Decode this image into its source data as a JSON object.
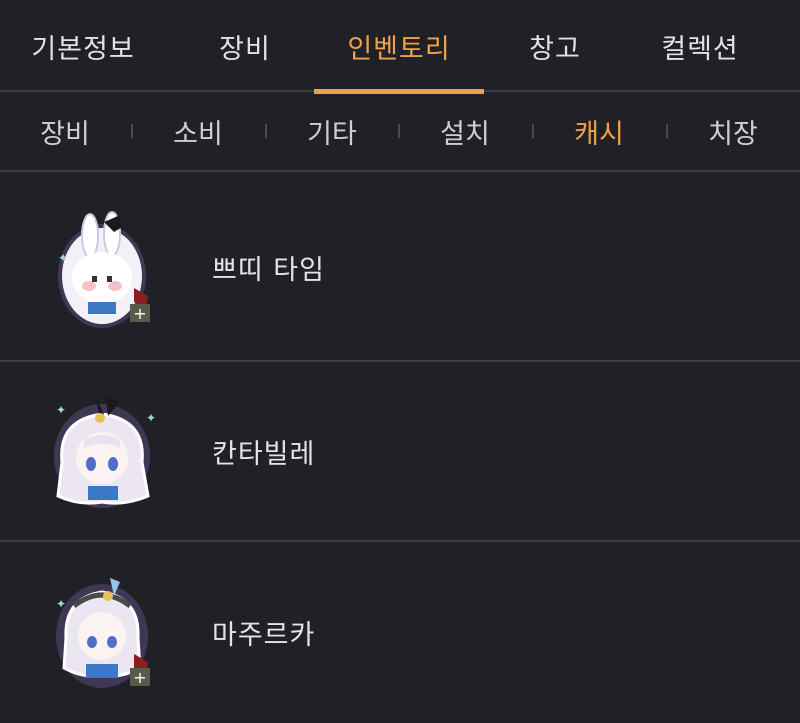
{
  "main_tabs": [
    {
      "label": "기본정보",
      "active": false
    },
    {
      "label": "장비",
      "active": false
    },
    {
      "label": "인벤토리",
      "active": true
    },
    {
      "label": "창고",
      "active": false
    },
    {
      "label": "컬렉션",
      "active": false
    }
  ],
  "sub_tabs": [
    {
      "label": "장비",
      "active": false
    },
    {
      "label": "소비",
      "active": false
    },
    {
      "label": "기타",
      "active": false
    },
    {
      "label": "설치",
      "active": false
    },
    {
      "label": "캐시",
      "active": true
    },
    {
      "label": "치장",
      "active": false
    }
  ],
  "items": [
    {
      "name": "쁘띠 타임",
      "icon": "bunny-pet-icon"
    },
    {
      "name": "칸타빌레",
      "icon": "girl-pet-icon"
    },
    {
      "name": "마주르카",
      "icon": "girl-pet-icon"
    }
  ],
  "colors": {
    "background": "#202126",
    "accent": "#f0a04b",
    "divider": "#3c3d44"
  }
}
